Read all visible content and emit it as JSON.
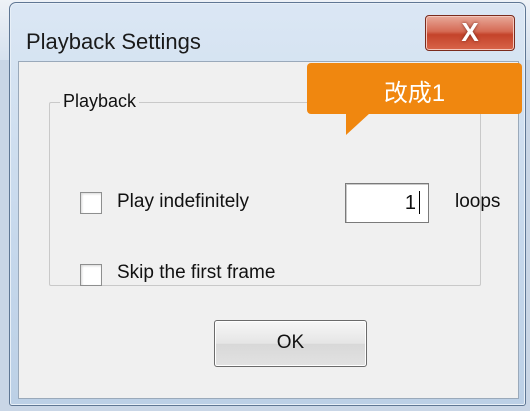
{
  "window": {
    "title": "Playback Settings",
    "close_label": "X"
  },
  "group": {
    "label": "Playback",
    "play_indefinitely": {
      "label": "Play indefinitely",
      "checked": false
    },
    "loops": {
      "value": "1",
      "unit": "loops"
    },
    "skip_first_frame": {
      "label": "Skip the first frame",
      "checked": false
    }
  },
  "buttons": {
    "ok": "OK"
  },
  "annotation": {
    "text": "改成1",
    "color": "#f0870f"
  }
}
